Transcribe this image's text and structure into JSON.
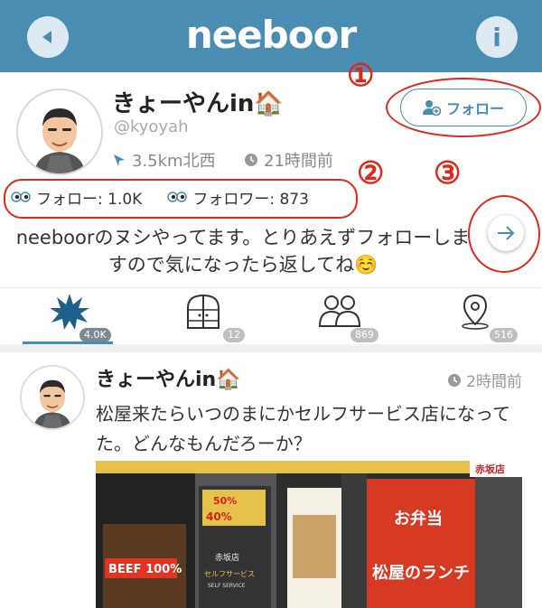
{
  "header": {
    "logo": "neeboor",
    "info_label": "i"
  },
  "profile": {
    "username": "きょーやんin🏠",
    "handle": "@kyoyah",
    "distance": "3.5km北西",
    "last_active": "21時間前",
    "follow_button_label": "フォロー",
    "following_label": "フォロー: 1.0K",
    "followers_label": "フォロワー: 873",
    "bio": "neeboorのヌシやってます。とりあえずフォローしますので気になったら返してね☺️"
  },
  "annotations": {
    "one": "①",
    "two": "②",
    "three": "③"
  },
  "tabs": [
    {
      "icon": "burst-icon",
      "badge": "4.0K",
      "active": true
    },
    {
      "icon": "door-icon",
      "badge": "12"
    },
    {
      "icon": "people-icon",
      "badge": "869"
    },
    {
      "icon": "location-pin-icon",
      "badge": "516"
    }
  ],
  "post": {
    "username": "きょーやんin🏠",
    "time": "2時間前",
    "text": "松屋来たらいつのまにかセルフサービス店になってた。どんなもんだろーか？",
    "photo_signs": {
      "discount": "50%",
      "discount2": "40%",
      "beef": "BEEF 100%",
      "store": "赤坂店",
      "self_service": "セルフサービス",
      "self_service_en": "SELF SERVICE",
      "lunch": "松屋のランチ",
      "bento": "お弁当",
      "akasaka": "赤坂店"
    }
  },
  "colors": {
    "header": "#4a8db3",
    "accent": "#4a8db3",
    "annotation": "#e0281d"
  }
}
